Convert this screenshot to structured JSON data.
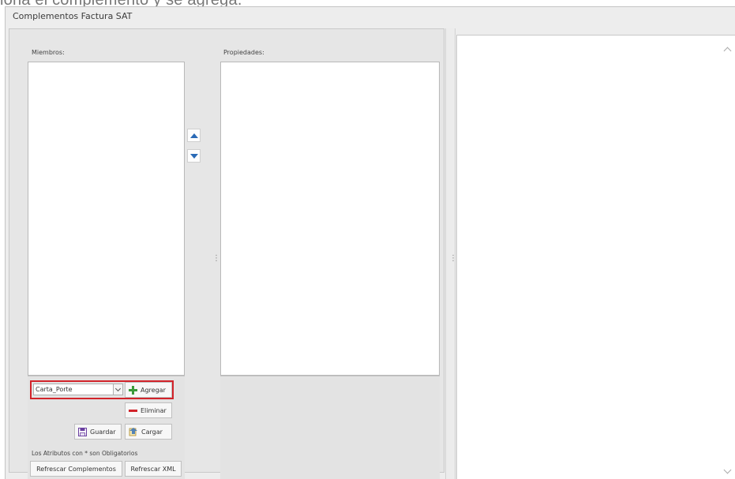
{
  "caption": "iona el complemento y se agrega.",
  "window": {
    "title": "Complementos Factura SAT"
  },
  "members": {
    "label": "Miembros:"
  },
  "properties": {
    "label": "Propiedades:"
  },
  "controls": {
    "complement_select_value": "Carta_Porte",
    "add_label": "Agregar",
    "remove_label": "Eliminar",
    "save_label": "Guardar",
    "load_label": "Cargar",
    "required_note": "Los Atributos con * son Obligatorios",
    "refresh_complements_label": "Refrescar Complementos",
    "refresh_xml_label": "Refrescar XML"
  },
  "colors": {
    "arrow_blue": "#2a6ab6",
    "add_green": "#3a9a3a",
    "remove_red": "#d2232a",
    "highlight_red": "#d2232a"
  },
  "icons": [
    "move-up-icon",
    "move-down-icon",
    "plus-icon",
    "minus-icon",
    "floppy-disk-icon",
    "load-icon",
    "chevron-down-icon",
    "scroll-up-icon",
    "scroll-down-icon"
  ]
}
